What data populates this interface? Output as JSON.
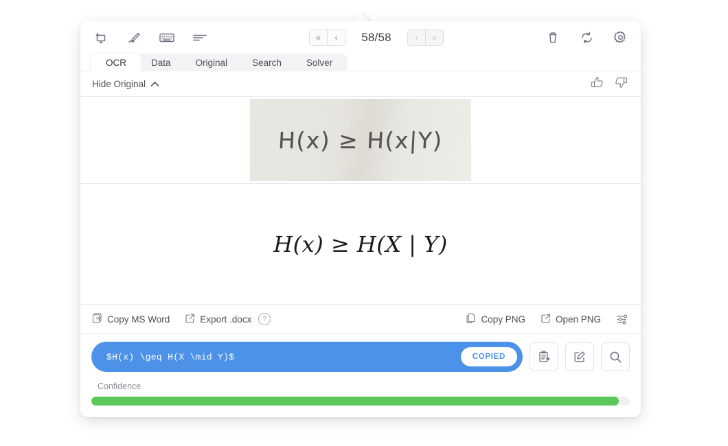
{
  "window": {
    "toolbar": {
      "icons": [
        {
          "name": "snip-capture-icon",
          "label": "Snip"
        },
        {
          "name": "pen-draw-icon",
          "label": "Draw"
        },
        {
          "name": "keyboard-icon",
          "label": "Keyboard"
        },
        {
          "name": "text-lines-icon",
          "label": "Text"
        }
      ],
      "nav": {
        "first_label": "«",
        "prev_label": "‹",
        "next_label": "›",
        "last_label": "»",
        "counter": "58/58",
        "current_page": 58,
        "total_pages": 58,
        "next_disabled": true,
        "last_disabled": true
      },
      "right_icons": [
        {
          "name": "trash-icon",
          "label": "Delete"
        },
        {
          "name": "refresh-icon",
          "label": "Retry"
        },
        {
          "name": "gear-icon",
          "label": "Settings"
        }
      ]
    },
    "tabs": [
      {
        "label": "OCR",
        "active": true
      },
      {
        "label": "Data",
        "active": false
      },
      {
        "label": "Original",
        "active": false
      },
      {
        "label": "Search",
        "active": false
      },
      {
        "label": "Solver",
        "active": false
      }
    ],
    "original_panel": {
      "toggle_label": "Hide Original",
      "chevron": "∧",
      "handwriting_text": "H(x) ≥ H(x|Y)",
      "feedback": [
        {
          "name": "thumbs-up-icon",
          "label": "Good result"
        },
        {
          "name": "thumbs-down-icon",
          "label": "Bad result"
        }
      ]
    },
    "rendered": {
      "math_left": "H(x)",
      "math_rel": " ≥ ",
      "math_right": "H(X | Y)"
    },
    "export_bar": {
      "copy_word_label": "Copy MS Word",
      "export_docx_label": "Export .docx",
      "help_label": "?",
      "copy_png_label": "Copy PNG",
      "open_png_label": "Open PNG",
      "sliders_label": "Options"
    },
    "result": {
      "latex": "$H(x) \\geq H(X \\mid Y)$",
      "copied_badge": "COPIED",
      "buttons": [
        {
          "name": "paste-clipboard-button",
          "label": "Paste"
        },
        {
          "name": "edit-button",
          "label": "Edit"
        },
        {
          "name": "search-button",
          "label": "Search"
        }
      ]
    },
    "confidence": {
      "label": "Confidence",
      "percent": 98,
      "color": "#5cc75a"
    }
  },
  "colors": {
    "accent_blue": "#4c92e8",
    "confidence_green": "#5cc75a",
    "tab_inactive": "#f2f3f4",
    "icon_gray": "#6b7280"
  }
}
